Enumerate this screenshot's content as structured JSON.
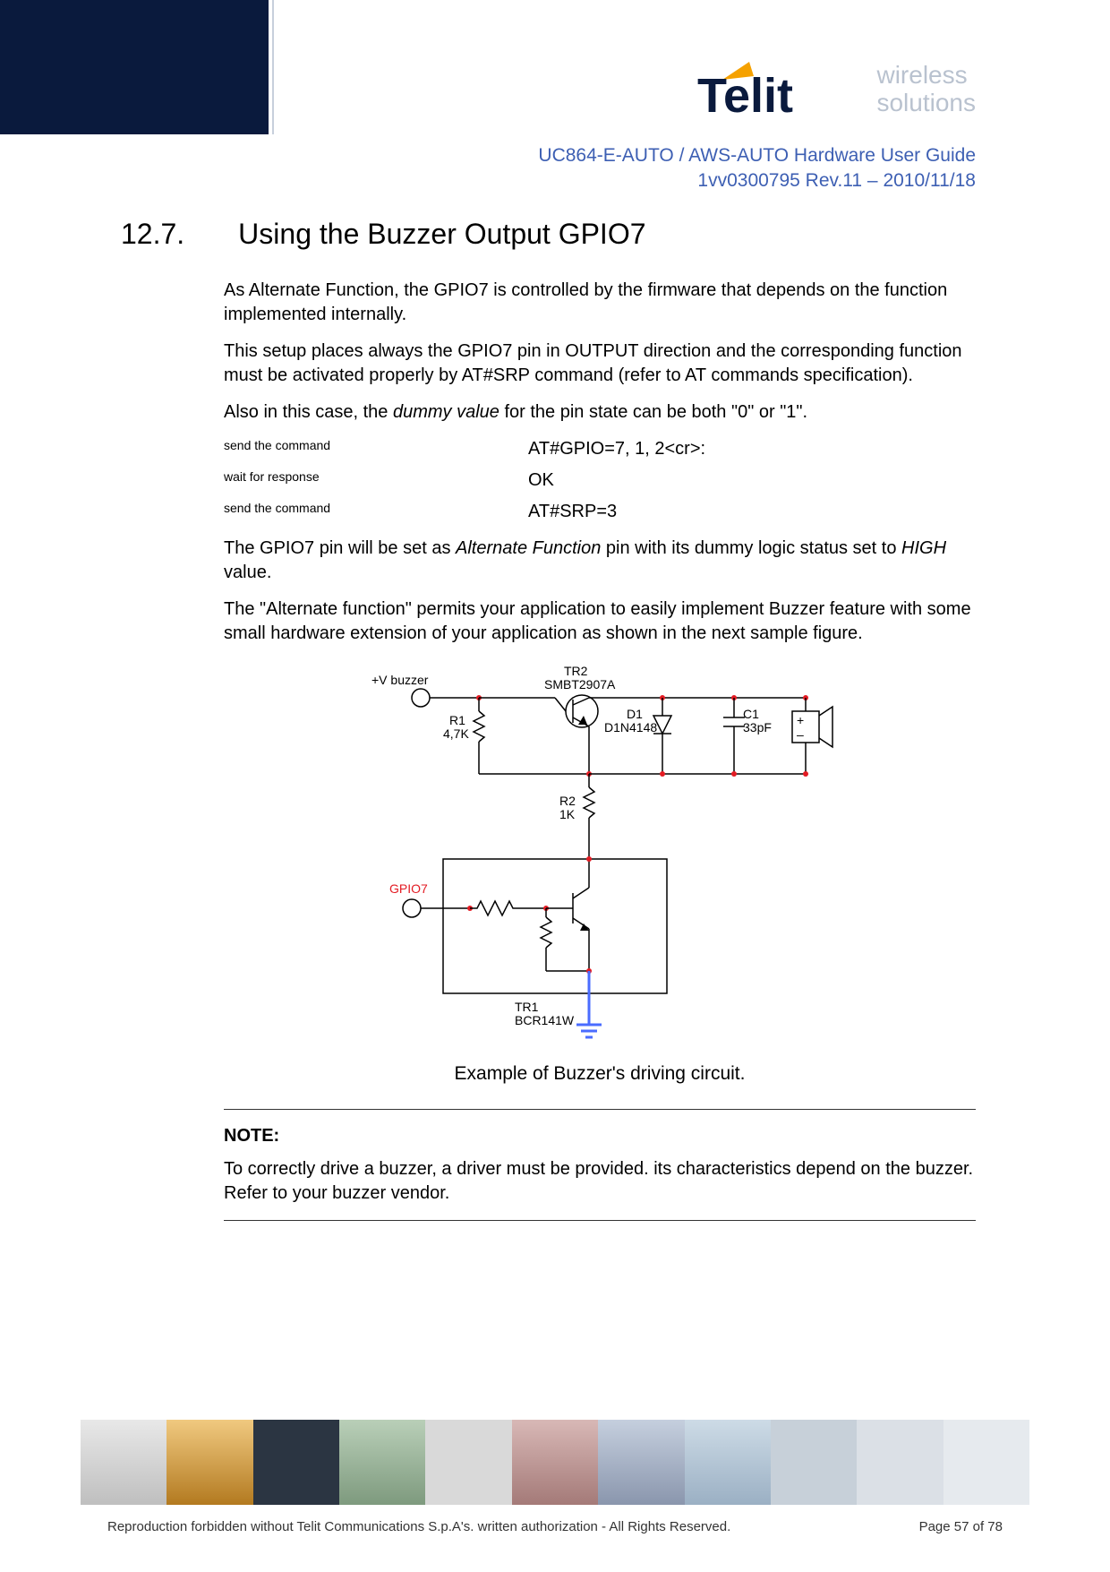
{
  "header": {
    "brand": "Telit",
    "tagline_l1": "wireless",
    "tagline_l2": "solutions",
    "doc_title": "UC864-E-AUTO / AWS-AUTO Hardware User Guide",
    "doc_rev": "1vv0300795 Rev.11 – 2010/11/18"
  },
  "section": {
    "number": "12.7.",
    "title": "Using the Buzzer Output GPIO7"
  },
  "paragraphs": {
    "p1": "As Alternate Function, the GPIO7 is controlled by the firmware that depends on the function implemented internally.",
    "p2": "This setup places always the GPIO7 pin in OUTPUT direction and the corresponding function must be activated properly by AT#SRP command (refer to AT commands specification).",
    "p3a": "Also in this case, the ",
    "p3b": "dummy value",
    "p3c": " for the pin state can be both \"0\" or \"1\".",
    "cmd1_l": "send the command",
    "cmd1_r": "AT#GPIO=7, 1, 2<cr>:",
    "cmd2_l": "wait for response",
    "cmd2_r": "OK",
    "cmd3_l": "send the command",
    "cmd3_r": "AT#SRP=3",
    "p4a": "The GPIO7 pin will be set as ",
    "p4b": "Alternate Function",
    "p4c": " pin with its dummy logic status set to ",
    "p4d": "HIGH",
    "p4e": " value.",
    "p5": "The \"Alternate function\" permits your application to easily implement Buzzer feature with some small hardware extension of your application as shown in the next sample figure."
  },
  "circuit": {
    "vbuzzer": "+V buzzer",
    "tr2": "TR2",
    "tr2_part": "SMBT2907A",
    "r1": "R1",
    "r1_val": "4,7K",
    "d1": "D1",
    "d1_part": "D1N4148",
    "c1": "C1",
    "c1_val": "33pF",
    "r2": "R2",
    "r2_val": "1K",
    "gpio7": "GPIO7",
    "tr1": "TR1",
    "tr1_part": "BCR141W",
    "plus": "+",
    "minus": "–",
    "caption": "Example of Buzzer's driving circuit."
  },
  "note": {
    "heading": "NOTE:",
    "body": "To correctly drive a buzzer, a driver must be provided. its characteristics depend on the buzzer. Refer to your buzzer vendor."
  },
  "footer": {
    "copyright": "Reproduction forbidden without Telit Communications S.p.A's. written authorization - All Rights Reserved.",
    "page": "Page 57 of 78"
  },
  "thumb_colors": [
    "#e4e4e4",
    "#d8a85a",
    "#2f3947",
    "#a6b9a3",
    "#d6d6d6",
    "#c4a5a3",
    "#9aa3b8",
    "#a7b9c7",
    "#b5bec6",
    "#cfd4d8",
    "#dfe3e6"
  ]
}
